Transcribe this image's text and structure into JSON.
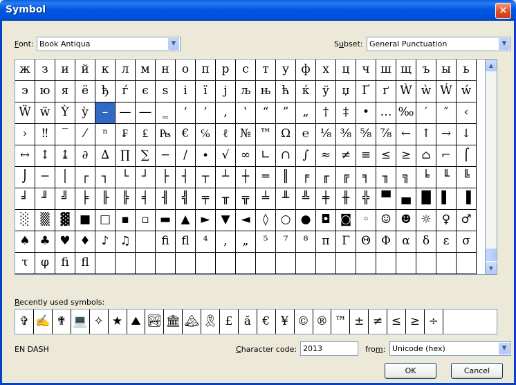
{
  "window": {
    "title": "Symbol",
    "close_glyph": "✕"
  },
  "font_label": "Font:",
  "font_value": "Book Antiqua",
  "subset_label": "Subset:",
  "subset_value": "General Punctuation",
  "grid": [
    [
      "ж",
      "з",
      "и",
      "й",
      "к",
      "л",
      "м",
      "н",
      "о",
      "п",
      "р",
      "с",
      "т",
      "у",
      "ф",
      "х",
      "ц",
      "ч",
      "ш",
      "щ",
      "ъ",
      "ы",
      "ь"
    ],
    [
      "э",
      "ю",
      "я",
      "ё",
      "ђ",
      "ѓ",
      "є",
      "s",
      "i",
      "ї",
      "j",
      "љ",
      "њ",
      "ћ",
      "ќ",
      "ў",
      "џ",
      "Ґ",
      "ґ",
      "Ẁ",
      "ẁ",
      "Ẃ",
      "ẃ"
    ],
    [
      "Ẅ",
      "ẅ",
      "Ỳ",
      "ỳ",
      "–",
      "—",
      "―",
      "‗",
      "‘",
      "’",
      "‚",
      "‛",
      "“",
      "”",
      "„",
      "†",
      "‡",
      "•",
      "…",
      "‰",
      "′",
      "″",
      "‹"
    ],
    [
      "›",
      "‼",
      "‾",
      "⁄",
      "ⁿ",
      "₣",
      "₤",
      "₧",
      "€",
      "℅",
      "ℓ",
      "№",
      "™",
      "Ω",
      "℮",
      "⅛",
      "⅜",
      "⅝",
      "⅞",
      "←",
      "↑",
      "→",
      "↓"
    ],
    [
      "↔",
      "↕",
      "↨",
      "∂",
      "∆",
      "∏",
      "∑",
      "−",
      "∕",
      "∙",
      "√",
      "∞",
      "∟",
      "∩",
      "∫",
      "≈",
      "≠",
      "≡",
      "≤",
      "≥",
      "⌂",
      "⌐",
      "⌠"
    ],
    [
      "⌡",
      "─",
      "│",
      "┌",
      "┐",
      "└",
      "┘",
      "├",
      "┤",
      "┬",
      "┴",
      "┼",
      "═",
      "║",
      "╒",
      "╓",
      "╔",
      "╕",
      "╖",
      "╗",
      "╘",
      "╙",
      "╚"
    ],
    [
      "╛",
      "╜",
      "╝",
      "╞",
      "╟",
      "╠",
      "╡",
      "╢",
      "╣",
      "╤",
      "╥",
      "╦",
      "╧",
      "╨",
      "╩",
      "╪",
      "╫",
      "╬",
      "▀",
      "▄",
      "█",
      "▌",
      "▐"
    ],
    [
      "░",
      "▒",
      "▓",
      "■",
      "□",
      "▪",
      "▫",
      "▬",
      "▲",
      "►",
      "▼",
      "◄",
      "◊",
      "○",
      "●",
      "◘",
      "◙",
      "◦",
      "☺",
      "☻",
      "☼",
      "♀",
      "♂"
    ],
    [
      "♠",
      "♣",
      "♥",
      "♦",
      "♪",
      "♫",
      "",
      "fi",
      "fl",
      "⁴",
      "‚",
      "„",
      "⁵",
      "⁷",
      "⁸",
      "π",
      "Γ",
      "Θ",
      "Φ",
      "α",
      "δ",
      "ε",
      "σ"
    ],
    [
      "τ",
      "φ",
      "fi",
      "fl",
      "",
      "",
      "",
      "",
      "",
      "",
      "",
      "",
      "",
      "",
      "",
      "",
      "",
      "",
      "",
      "",
      "",
      "",
      ""
    ]
  ],
  "selected_symbol": "–",
  "recent_label": "Recently used symbols:",
  "recent_symbols": [
    "✞",
    "✍",
    "✟",
    "💻",
    "✧",
    "★",
    "⛰",
    "🏞",
    "🏛",
    "🏔",
    "🎗",
    "£",
    "ă",
    "€",
    "¥",
    "©",
    "®",
    "™",
    "±",
    "≠",
    "≤",
    "≥",
    "÷"
  ],
  "char_name": "EN DASH",
  "char_code_label": "Character code:",
  "char_code_value": "2013",
  "from_label": "from:",
  "from_value": "Unicode (hex)",
  "ok_label": "OK",
  "cancel_label": "Cancel",
  "icons": {
    "dropdown": "▼",
    "scroll_up": "▲",
    "scroll_down": "▼"
  }
}
